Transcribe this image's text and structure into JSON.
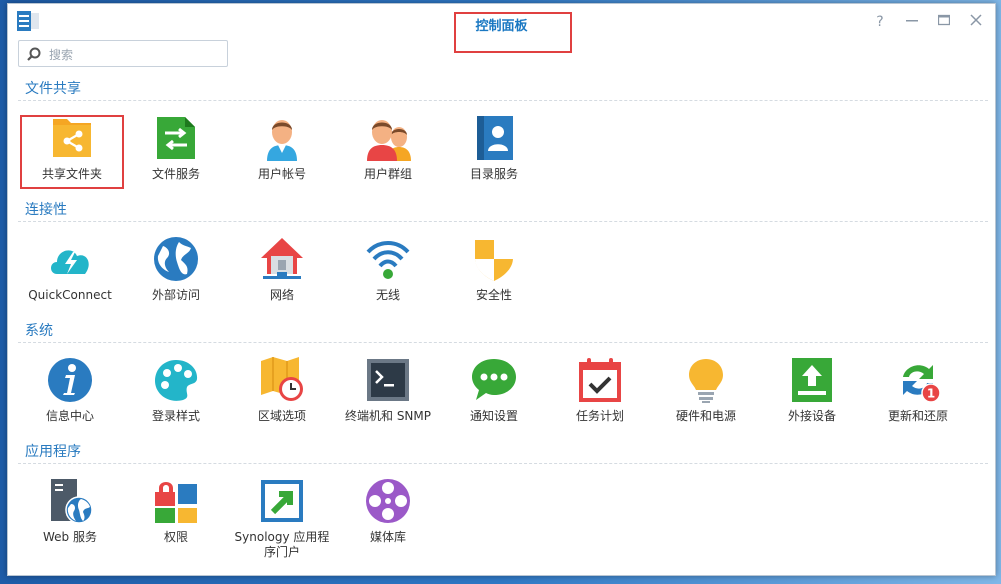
{
  "window": {
    "title": "控制面板"
  },
  "search": {
    "placeholder": "搜索"
  },
  "sections": [
    {
      "title": "文件共享",
      "items": [
        "共享文件夹",
        "文件服务",
        "用户帐号",
        "用户群组",
        "目录服务"
      ]
    },
    {
      "title": "连接性",
      "items": [
        "QuickConnect",
        "外部访问",
        "网络",
        "无线",
        "安全性"
      ]
    },
    {
      "title": "系统",
      "items": [
        "信息中心",
        "登录样式",
        "区域选项",
        "终端机和 SNMP",
        "通知设置",
        "任务计划",
        "硬件和电源",
        "外接设备",
        "更新和还原"
      ]
    },
    {
      "title": "应用程序",
      "items": [
        "Web 服务",
        "权限",
        "Synology 应用程序门户",
        "媒体库"
      ]
    }
  ],
  "badge": {
    "update_count": "1"
  },
  "colors": {
    "accent": "#2a7bc0",
    "highlight": "#e04040"
  },
  "icons": [
    "shared-folder-icon",
    "file-services-icon",
    "user-icon",
    "group-icon",
    "directory-icon",
    "quickconnect-icon",
    "external-access-icon",
    "network-icon",
    "wireless-icon",
    "security-icon",
    "info-center-icon",
    "theme-icon",
    "regional-icon",
    "terminal-icon",
    "notification-icon",
    "task-scheduler-icon",
    "hardware-power-icon",
    "external-devices-icon",
    "update-restore-icon",
    "web-services-icon",
    "privileges-icon",
    "application-portal-icon",
    "media-library-icon"
  ]
}
